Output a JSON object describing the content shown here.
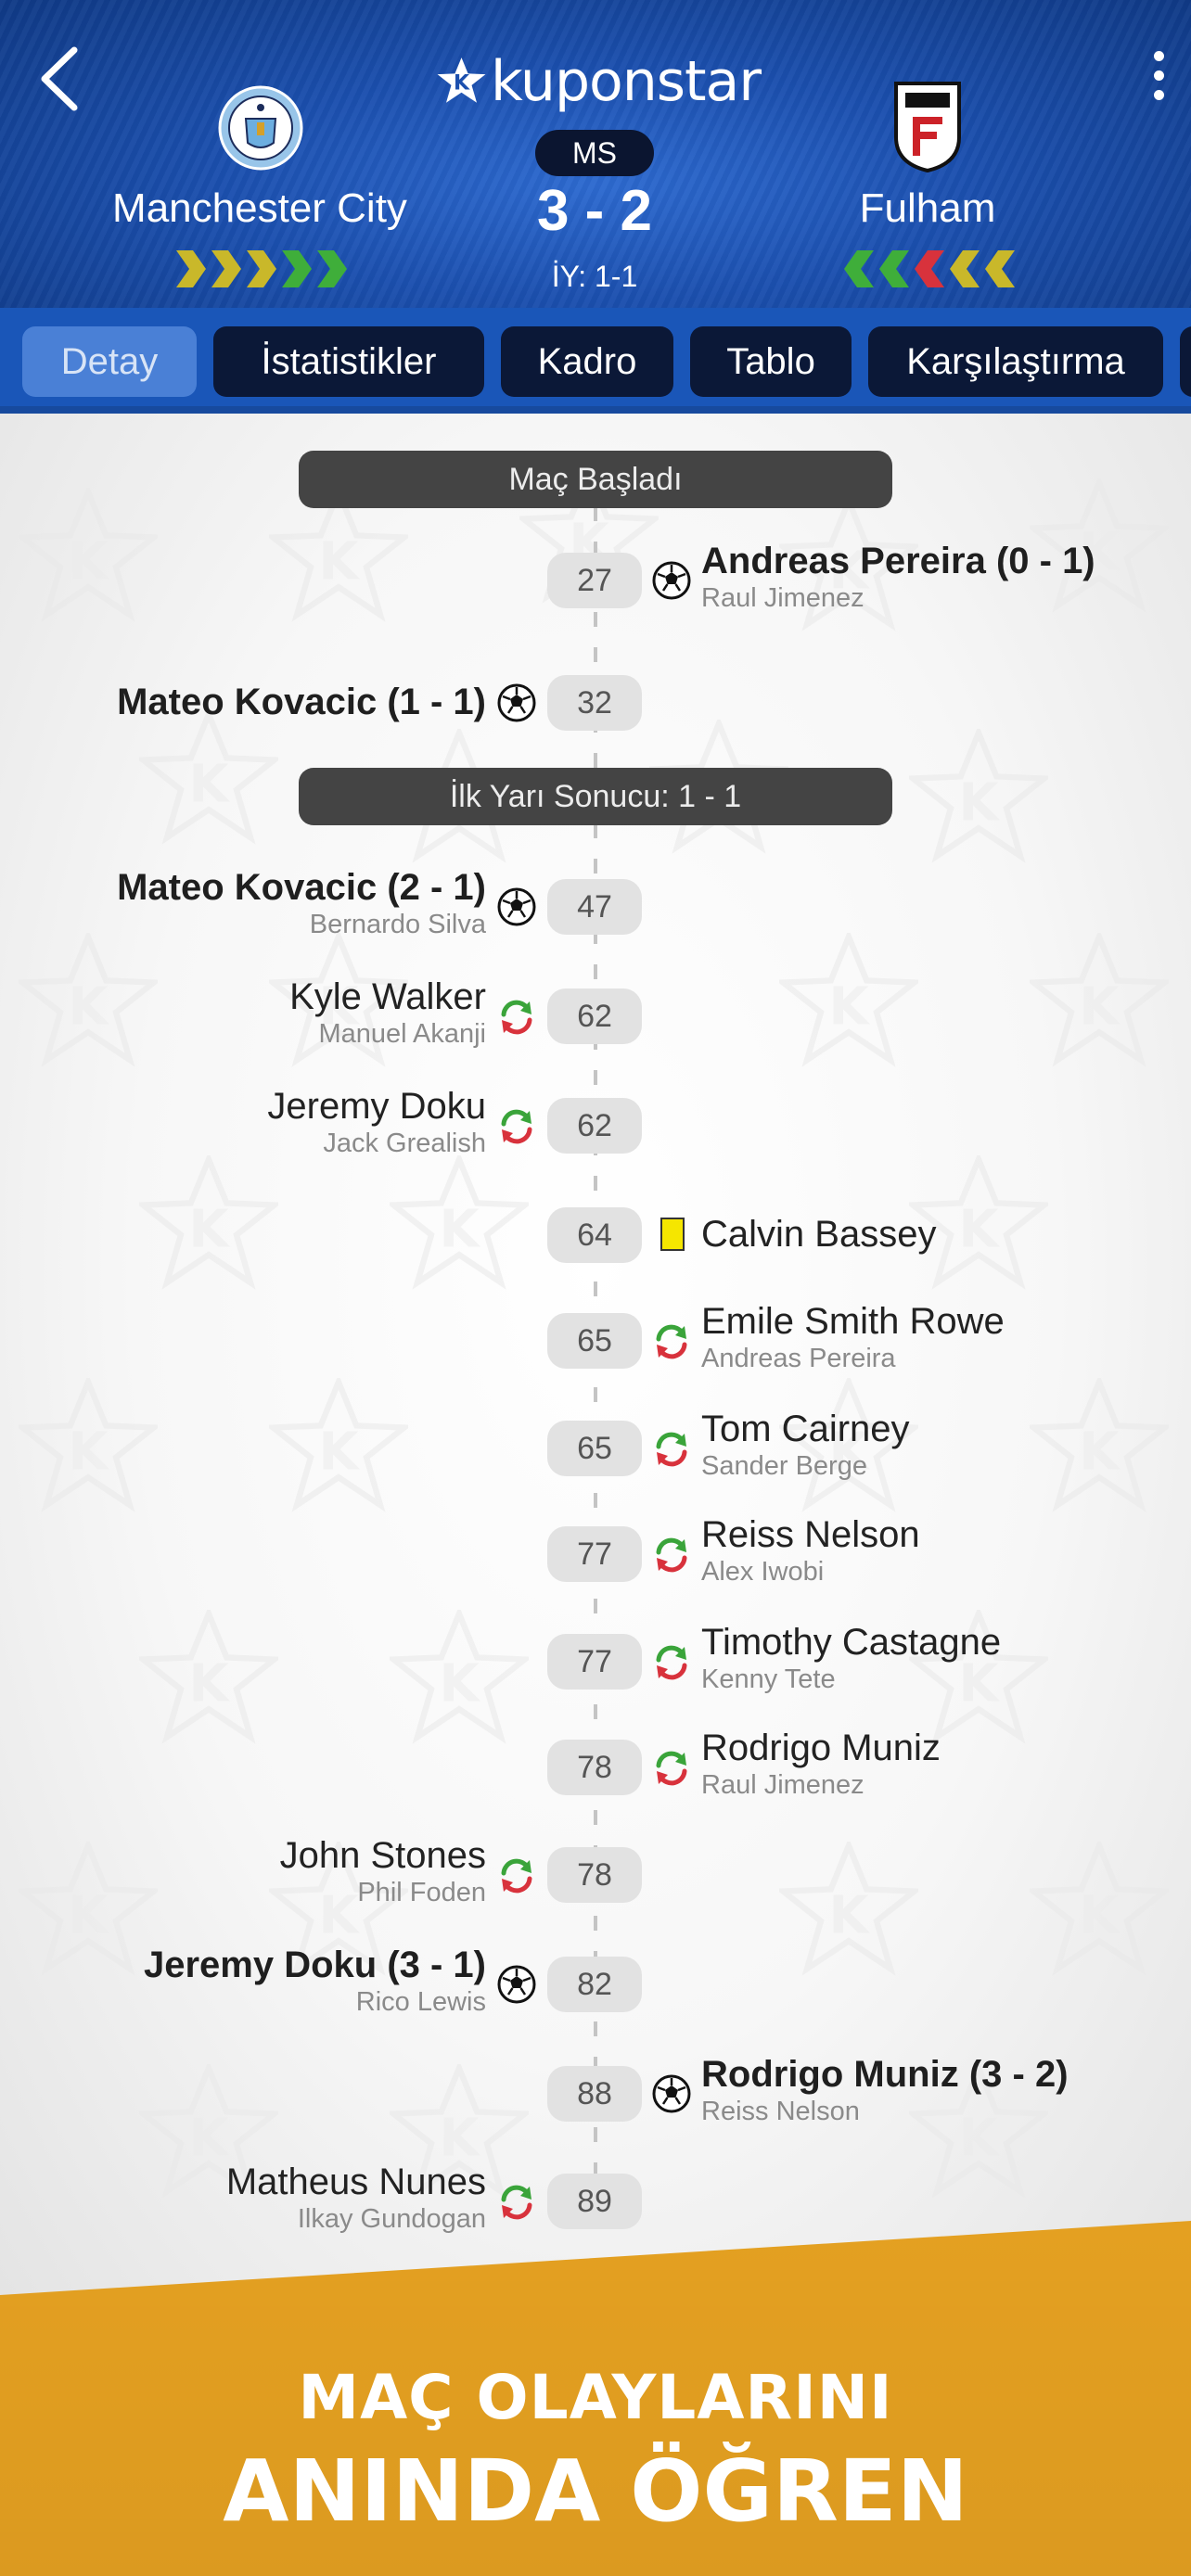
{
  "app": {
    "brand": "kuponstar"
  },
  "match": {
    "home_team": "Manchester City",
    "away_team": "Fulham",
    "status": "MS",
    "score": "3 - 2",
    "halftime": "İY: 1-1",
    "home_form": [
      "#c9b82a",
      "#c9b82a",
      "#c9b82a",
      "#3fae3a",
      "#3fae3a"
    ],
    "away_form": [
      "#3fae3a",
      "#3fae3a",
      "#d8323c",
      "#c9b82a",
      "#c9b82a"
    ]
  },
  "tabs": [
    {
      "label": "Detay",
      "active": true
    },
    {
      "label": "İstatistikler",
      "active": false
    },
    {
      "label": "Kadro",
      "active": false
    },
    {
      "label": "Tablo",
      "active": false
    },
    {
      "label": "Karşılaştırma",
      "active": false
    }
  ],
  "timeline": {
    "markers": [
      "Maç Başladı",
      "İlk Yarı Sonucu: 1 - 1"
    ],
    "events": [
      {
        "minute": "27",
        "side": "away",
        "type": "goal",
        "player": "Andreas Pereira (0 - 1)",
        "sub": "Raul Jimenez"
      },
      {
        "minute": "32",
        "side": "home",
        "type": "goal",
        "player": "Mateo Kovacic (1 - 1)",
        "sub": ""
      },
      {
        "minute": "47",
        "side": "home",
        "type": "goal",
        "player": "Mateo Kovacic (2 - 1)",
        "sub": "Bernardo Silva"
      },
      {
        "minute": "62",
        "side": "home",
        "type": "substitution",
        "player": "Kyle Walker",
        "sub": "Manuel Akanji"
      },
      {
        "minute": "62",
        "side": "home",
        "type": "substitution",
        "player": "Jeremy Doku",
        "sub": "Jack Grealish"
      },
      {
        "minute": "64",
        "side": "away",
        "type": "yellow-card",
        "player": "Calvin Bassey",
        "sub": ""
      },
      {
        "minute": "65",
        "side": "away",
        "type": "substitution",
        "player": "Emile Smith Rowe",
        "sub": "Andreas Pereira"
      },
      {
        "minute": "65",
        "side": "away",
        "type": "substitution",
        "player": "Tom Cairney",
        "sub": "Sander Berge"
      },
      {
        "minute": "77",
        "side": "away",
        "type": "substitution",
        "player": "Reiss Nelson",
        "sub": "Alex Iwobi"
      },
      {
        "minute": "77",
        "side": "away",
        "type": "substitution",
        "player": "Timothy Castagne",
        "sub": "Kenny Tete"
      },
      {
        "minute": "78",
        "side": "away",
        "type": "substitution",
        "player": "Rodrigo Muniz",
        "sub": "Raul Jimenez"
      },
      {
        "minute": "78",
        "side": "home",
        "type": "substitution",
        "player": "John Stones",
        "sub": "Phil Foden"
      },
      {
        "minute": "82",
        "side": "home",
        "type": "goal",
        "player": "Jeremy Doku (3 - 1)",
        "sub": "Rico Lewis"
      },
      {
        "minute": "88",
        "side": "away",
        "type": "goal",
        "player": "Rodrigo Muniz (3 - 2)",
        "sub": "Reiss Nelson"
      },
      {
        "minute": "89",
        "side": "home",
        "type": "substitution",
        "player": "Matheus Nunes",
        "sub": "Ilkay Gundogan"
      }
    ]
  },
  "banner": {
    "line1": "MAÇ OLAYLARINI",
    "line2": "ANINDA ÖĞREN"
  },
  "colors": {
    "header_blue": "#1b4fae",
    "tab_active": "#4a80d6",
    "tab_inactive": "#0b1837",
    "banner_orange": "#e4a021",
    "sub_in_green": "#3aa43a",
    "sub_out_red": "#d8323c",
    "yellow_card": "#f5e600"
  }
}
